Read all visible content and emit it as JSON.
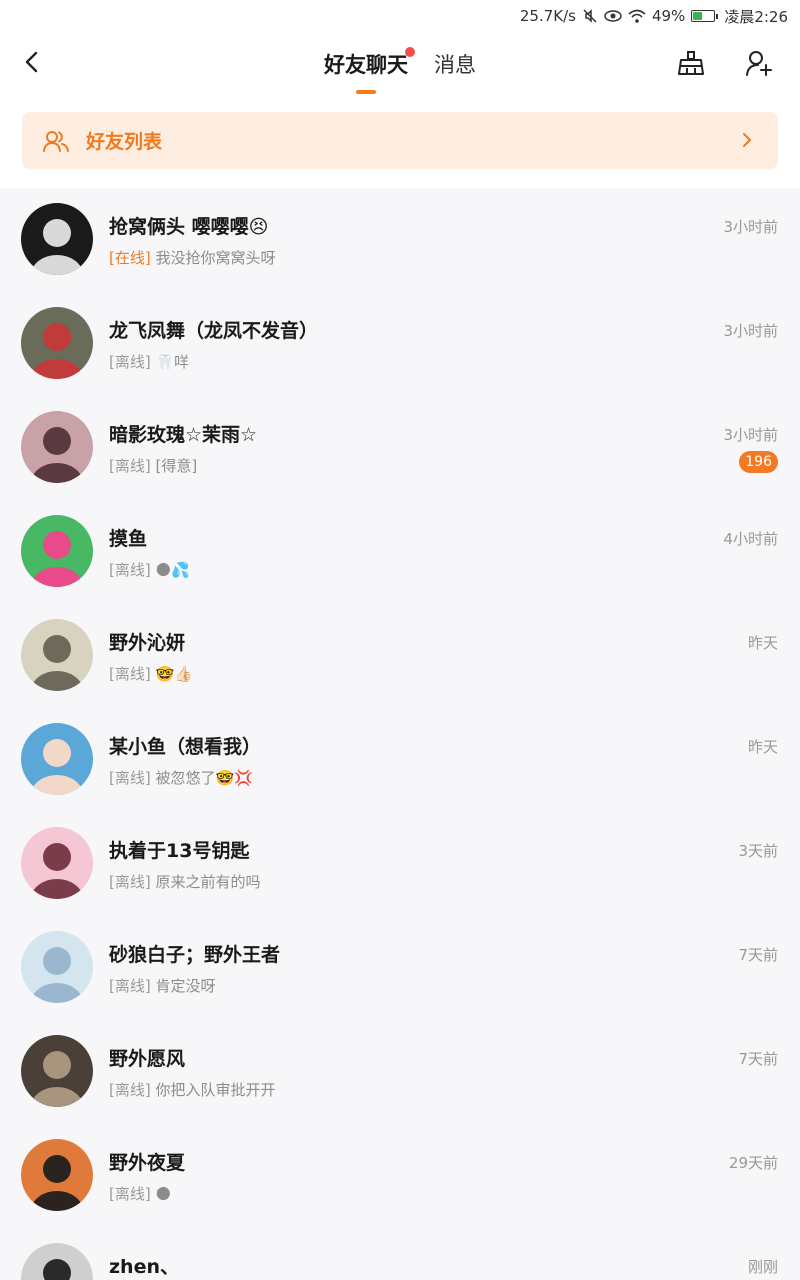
{
  "status_bar": {
    "net_speed": "25.7K/s",
    "mute_icon": "mute-icon",
    "eye_icon": "eye-icon",
    "wifi_icon": "wifi-icon",
    "battery_percent": "49%",
    "battery_level": 0.49,
    "time": "凌晨2:26"
  },
  "nav": {
    "back_icon": "back-arrow-icon",
    "tabs": [
      {
        "label": "好友聊天",
        "active": true,
        "has_dot": true
      },
      {
        "label": "消息",
        "active": false,
        "has_dot": false
      }
    ],
    "right_icons": [
      "broom-icon",
      "add-friend-icon"
    ]
  },
  "friend_banner": {
    "icon": "friends-icon",
    "label": "好友列表",
    "arrow": "chevron-right-icon"
  },
  "chats": [
    {
      "name": "抢窝俩头 嘤嘤嘤😣",
      "status": "[在线]",
      "online": true,
      "message": "我没抢你窝窝头呀",
      "time": "3小时前",
      "badge": ""
    },
    {
      "name": "龙飞凤舞（龙凤不发音）",
      "status": "[离线]",
      "online": false,
      "message": "🦷咩",
      "time": "3小时前",
      "badge": ""
    },
    {
      "name": "暗影玫瑰☆茉雨☆",
      "status": "[离线]",
      "online": false,
      "message": "[得意]",
      "time": "3小时前",
      "badge": "196"
    },
    {
      "name": "摸鱼",
      "status": "[离线]",
      "online": false,
      "message": "🌑💦",
      "time": "4小时前",
      "badge": ""
    },
    {
      "name": "野外沁妍",
      "status": "[离线]",
      "online": false,
      "message": "🤓👍🏻",
      "time": "昨天",
      "badge": ""
    },
    {
      "name": "某小鱼（想看我）",
      "status": "[离线]",
      "online": false,
      "message": "被忽悠了🤓💢",
      "time": "昨天",
      "badge": ""
    },
    {
      "name": "执着于13号钥匙",
      "status": "[离线]",
      "online": false,
      "message": "原来之前有的吗",
      "time": "3天前",
      "badge": ""
    },
    {
      "name": "砂狼白子；野外王者",
      "status": "[离线]",
      "online": false,
      "message": "肯定没呀",
      "time": "7天前",
      "badge": ""
    },
    {
      "name": "野外愿风",
      "status": "[离线]",
      "online": false,
      "message": "你把入队审批开开",
      "time": "7天前",
      "badge": ""
    },
    {
      "name": "野外夜夏",
      "status": "[离线]",
      "online": false,
      "message": "🌑",
      "time": "29天前",
      "badge": ""
    },
    {
      "name": "zhen、",
      "status": "",
      "online": false,
      "message": "",
      "time": "刚刚",
      "badge": ""
    }
  ],
  "colors": {
    "accent": "#f07a1f",
    "badge": "#f27a24",
    "dot": "#f2504b",
    "banner_bg": "#fdeee1",
    "list_bg": "#f7f7f9"
  }
}
